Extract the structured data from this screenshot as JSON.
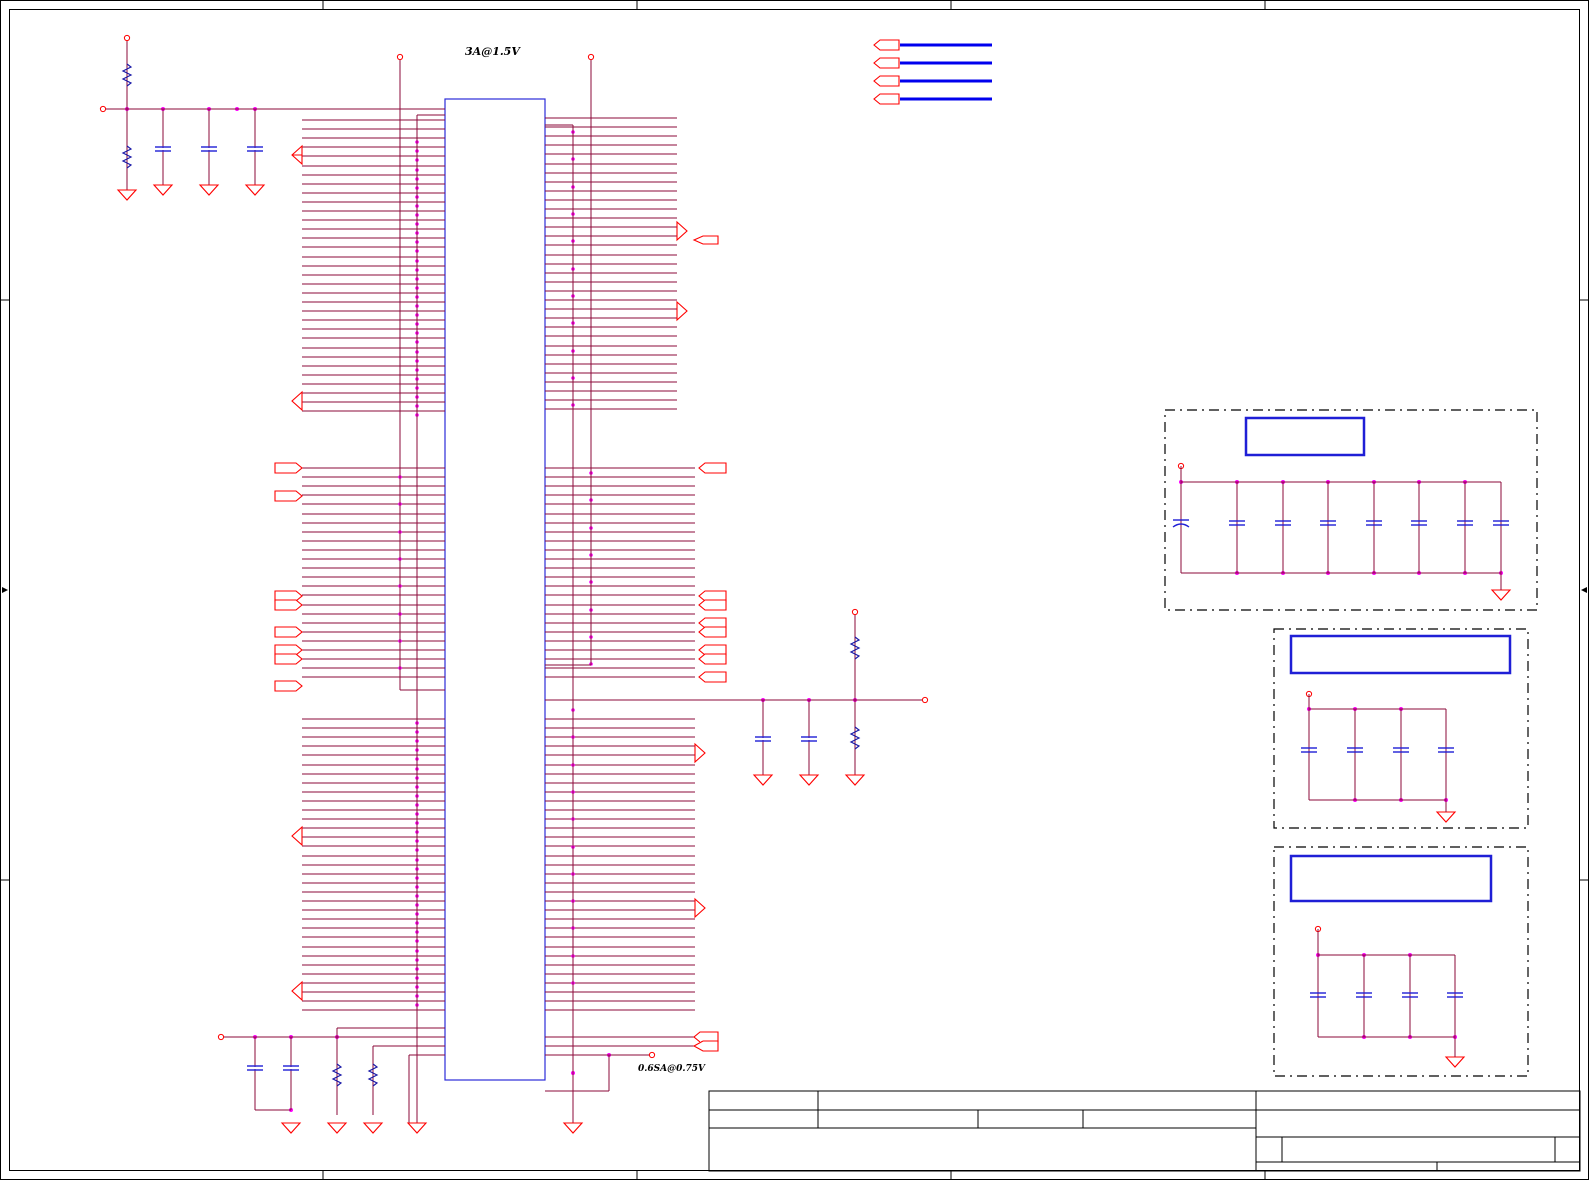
{
  "annotations": {
    "current_rating_top": "3A@1.5V",
    "current_rating_vtt": "0.6SA@0.75V"
  },
  "colors": {
    "wire": "#8b0a3a",
    "symbol": "#ff0000",
    "resistor": "#1a1aa8",
    "capacitor": "#1f1fd6",
    "junction": "#ff00ff",
    "ic_outline": "#2b2bd9",
    "frame": "#000000",
    "bus_line": "#0000ee"
  },
  "icons": {
    "ground": "ground-icon",
    "power_pin": "power-pin-icon",
    "resistor": "resistor-icon",
    "capacitor": "capacitor-icon",
    "port_flag": "port-flag-icon",
    "off_page_connector": "off-page-connector-icon",
    "zone_marker": "zone-marker-icon"
  }
}
